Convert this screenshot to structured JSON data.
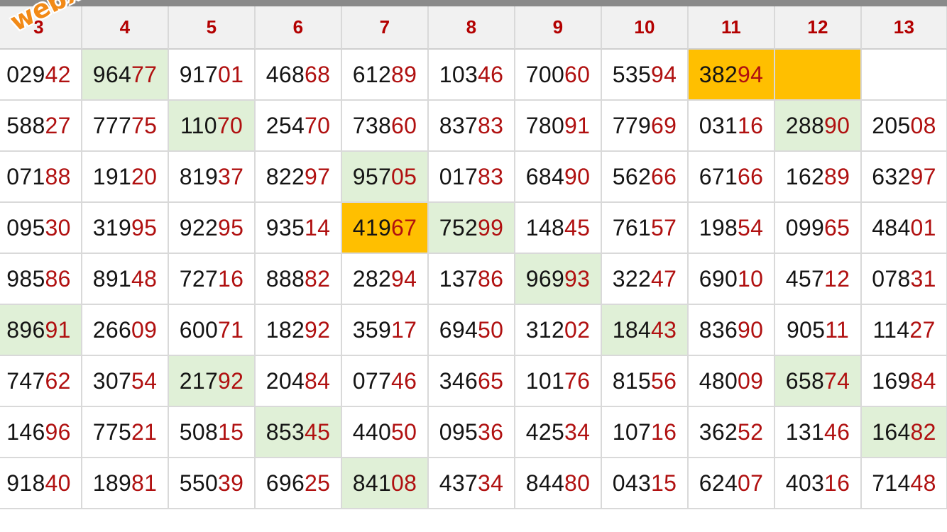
{
  "watermark": "webxoso.net",
  "colors": {
    "header_text": "#b30000",
    "tail_digits": "#b01010",
    "green": "#e0f0d7",
    "orange": "#ffbf00"
  },
  "headers": [
    "3",
    "4",
    "5",
    "6",
    "7",
    "8",
    "9",
    "10",
    "11",
    "12",
    "13"
  ],
  "rows": [
    [
      {
        "h": "029",
        "t": "42"
      },
      {
        "h": "964",
        "t": "77",
        "c": "green"
      },
      {
        "h": "917",
        "t": "01"
      },
      {
        "h": "468",
        "t": "68"
      },
      {
        "h": "612",
        "t": "89"
      },
      {
        "h": "103",
        "t": "46"
      },
      {
        "h": "700",
        "t": "60"
      },
      {
        "h": "535",
        "t": "94"
      },
      {
        "h": "382",
        "t": "94",
        "c": "orange"
      },
      {
        "h": "",
        "t": "",
        "c": "orange"
      },
      {
        "h": "",
        "t": ""
      }
    ],
    [
      {
        "h": "588",
        "t": "27"
      },
      {
        "h": "777",
        "t": "75"
      },
      {
        "h": "110",
        "t": "70",
        "c": "green"
      },
      {
        "h": "254",
        "t": "70"
      },
      {
        "h": "738",
        "t": "60"
      },
      {
        "h": "837",
        "t": "83"
      },
      {
        "h": "780",
        "t": "91"
      },
      {
        "h": "779",
        "t": "69"
      },
      {
        "h": "031",
        "t": "16"
      },
      {
        "h": "288",
        "t": "90",
        "c": "green"
      },
      {
        "h": "205",
        "t": "08"
      }
    ],
    [
      {
        "h": "071",
        "t": "88"
      },
      {
        "h": "191",
        "t": "20"
      },
      {
        "h": "819",
        "t": "37"
      },
      {
        "h": "822",
        "t": "97"
      },
      {
        "h": "957",
        "t": "05",
        "c": "green"
      },
      {
        "h": "017",
        "t": "83"
      },
      {
        "h": "684",
        "t": "90"
      },
      {
        "h": "562",
        "t": "66"
      },
      {
        "h": "671",
        "t": "66"
      },
      {
        "h": "162",
        "t": "89"
      },
      {
        "h": "632",
        "t": "97"
      }
    ],
    [
      {
        "h": "095",
        "t": "30"
      },
      {
        "h": "319",
        "t": "95"
      },
      {
        "h": "922",
        "t": "95"
      },
      {
        "h": "935",
        "t": "14"
      },
      {
        "h": "419",
        "t": "67",
        "c": "orange"
      },
      {
        "h": "752",
        "t": "99",
        "c": "green"
      },
      {
        "h": "148",
        "t": "45"
      },
      {
        "h": "761",
        "t": "57"
      },
      {
        "h": "198",
        "t": "54"
      },
      {
        "h": "099",
        "t": "65"
      },
      {
        "h": "484",
        "t": "01"
      }
    ],
    [
      {
        "h": "985",
        "t": "86"
      },
      {
        "h": "891",
        "t": "48"
      },
      {
        "h": "727",
        "t": "16"
      },
      {
        "h": "888",
        "t": "82"
      },
      {
        "h": "282",
        "t": "94"
      },
      {
        "h": "137",
        "t": "86"
      },
      {
        "h": "969",
        "t": "93",
        "c": "green"
      },
      {
        "h": "322",
        "t": "47"
      },
      {
        "h": "690",
        "t": "10"
      },
      {
        "h": "457",
        "t": "12"
      },
      {
        "h": "078",
        "t": "31"
      }
    ],
    [
      {
        "h": "896",
        "t": "91",
        "c": "green"
      },
      {
        "h": "266",
        "t": "09"
      },
      {
        "h": "600",
        "t": "71"
      },
      {
        "h": "182",
        "t": "92"
      },
      {
        "h": "359",
        "t": "17"
      },
      {
        "h": "694",
        "t": "50"
      },
      {
        "h": "312",
        "t": "02"
      },
      {
        "h": "184",
        "t": "43",
        "c": "green"
      },
      {
        "h": "836",
        "t": "90"
      },
      {
        "h": "905",
        "t": "11"
      },
      {
        "h": "114",
        "t": "27"
      }
    ],
    [
      {
        "h": "747",
        "t": "62"
      },
      {
        "h": "307",
        "t": "54"
      },
      {
        "h": "217",
        "t": "92",
        "c": "green"
      },
      {
        "h": "204",
        "t": "84"
      },
      {
        "h": "077",
        "t": "46"
      },
      {
        "h": "346",
        "t": "65"
      },
      {
        "h": "101",
        "t": "76"
      },
      {
        "h": "815",
        "t": "56"
      },
      {
        "h": "480",
        "t": "09"
      },
      {
        "h": "658",
        "t": "74",
        "c": "green"
      },
      {
        "h": "169",
        "t": "84"
      }
    ],
    [
      {
        "h": "146",
        "t": "96"
      },
      {
        "h": "775",
        "t": "21"
      },
      {
        "h": "508",
        "t": "15"
      },
      {
        "h": "853",
        "t": "45",
        "c": "green"
      },
      {
        "h": "440",
        "t": "50"
      },
      {
        "h": "095",
        "t": "36"
      },
      {
        "h": "425",
        "t": "34"
      },
      {
        "h": "107",
        "t": "16"
      },
      {
        "h": "362",
        "t": "52"
      },
      {
        "h": "131",
        "t": "46"
      },
      {
        "h": "164",
        "t": "82",
        "c": "green"
      }
    ],
    [
      {
        "h": "918",
        "t": "40"
      },
      {
        "h": "189",
        "t": "81"
      },
      {
        "h": "550",
        "t": "39"
      },
      {
        "h": "696",
        "t": "25"
      },
      {
        "h": "841",
        "t": "08",
        "c": "green"
      },
      {
        "h": "437",
        "t": "34"
      },
      {
        "h": "844",
        "t": "80"
      },
      {
        "h": "043",
        "t": "15"
      },
      {
        "h": "624",
        "t": "07"
      },
      {
        "h": "403",
        "t": "16"
      },
      {
        "h": "714",
        "t": "48"
      }
    ]
  ]
}
